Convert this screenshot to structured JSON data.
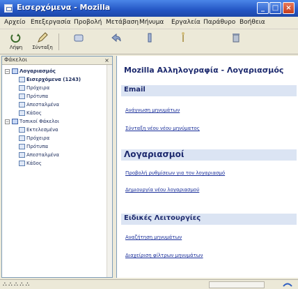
{
  "window": {
    "title": "Εισερχόμενα - Mozilla"
  },
  "menubar": {
    "items": [
      "Αρχείο",
      "Επεξεργασία",
      "Προβολή",
      "Μετάβαση",
      "Μήνυμα",
      "Εργαλεία",
      "Παράθυρο",
      "Βοήθεια"
    ]
  },
  "toolbar": {
    "buttons": [
      {
        "label": "Λήψη",
        "icon": "get-mail-icon"
      },
      {
        "label": "Σύνταξη",
        "icon": "compose-icon"
      },
      {
        "label": "",
        "icon": "address-book-icon"
      },
      {
        "label": "",
        "icon": "reply-icon"
      },
      {
        "label": "",
        "icon": "reply-all-icon"
      },
      {
        "label": "",
        "icon": "forward-icon"
      },
      {
        "label": "",
        "icon": "delete-icon"
      }
    ]
  },
  "folder_pane": {
    "header": "Φάκελοι",
    "tree": [
      {
        "label": "Λογαριασμός",
        "level": 0,
        "type": "account",
        "expanded": true
      },
      {
        "label": "Εισερχόμενα (1243)",
        "level": 1,
        "type": "folder",
        "bold": true
      },
      {
        "label": "Πρόχειρα",
        "level": 1,
        "type": "folder"
      },
      {
        "label": "Πρότυπα",
        "level": 1,
        "type": "folder"
      },
      {
        "label": "Απεσταλμένα",
        "level": 1,
        "type": "folder"
      },
      {
        "label": "Κάδος",
        "level": 1,
        "type": "folder"
      },
      {
        "label": "Τοπικοί Φάκελοι",
        "level": 0,
        "type": "account",
        "expanded": true
      },
      {
        "label": "Εκτελεσμένα",
        "level": 1,
        "type": "folder"
      },
      {
        "label": "Πρόχειρα",
        "level": 1,
        "type": "folder"
      },
      {
        "label": "Πρότυπα",
        "level": 1,
        "type": "folder"
      },
      {
        "label": "Απεσταλμένα",
        "level": 1,
        "type": "folder"
      },
      {
        "label": "Κάδος",
        "level": 1,
        "type": "folder"
      }
    ]
  },
  "main": {
    "page_title": "Mozilla Αλληλογραφία - Λογαριασμός",
    "sections": [
      {
        "title": "Email",
        "links": [
          "Ανάγνωση μηνυμάτων",
          "Σύνταξη νέου νέου μηνύματος"
        ]
      },
      {
        "title": "Λογαριασμοί",
        "links": [
          "Προβολή ρυθμίσεων για τον λογαριασμό",
          "Δημιουργία νέου λογαριασμού"
        ]
      },
      {
        "title": "Ειδικές Λειτουργίες",
        "links": [
          "Αναζήτηση μηνυμάτων",
          "Διαχείριση φίλτρων μηνυμάτων"
        ]
      }
    ]
  },
  "statusbar": {
    "text": "⛬ ⛬ ⛬ ⛬ ⛬"
  },
  "colors": {
    "titlebar": "#2456c4",
    "section_bar": "#dbe4f3",
    "heading": "#1d2a6e",
    "link": "#1a2f9a"
  }
}
